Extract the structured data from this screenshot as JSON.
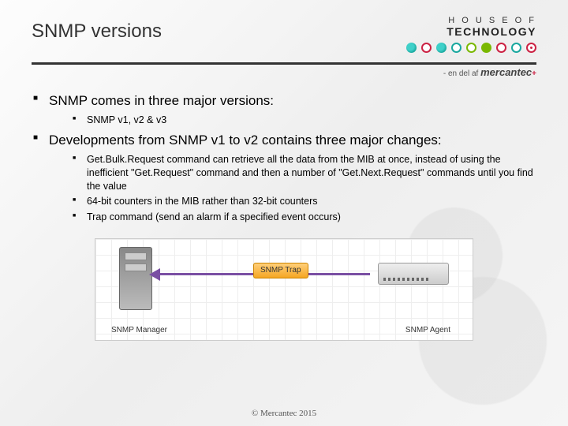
{
  "header": {
    "title": "SNMP versions",
    "brand_line1": "H O U S E  O F",
    "brand_line2": "TECHNOLOGY",
    "subbrand_prefix": "- en del af ",
    "subbrand_name": "mercantec",
    "subbrand_plus": "+"
  },
  "content": {
    "bullet1": "SNMP comes in three major versions:",
    "bullet1_sub1": "SNMP v1, v2 & v3",
    "bullet2": "Developments from SNMP v1 to v2 contains three major changes:",
    "bullet2_sub1": "Get.Bulk.Request command can retrieve all the data from the MIB at once, instead of using the inefficient \"Get.Request\" command and then a number of \"Get.Next.Request\" commands until you find the value",
    "bullet2_sub2": "64-bit counters in the MIB rather than 32-bit counters",
    "bullet2_sub3": "Trap command (send an alarm if a specified event occurs)"
  },
  "diagram": {
    "trap_label": "SNMP Trap",
    "manager_label": "SNMP Manager",
    "agent_label": "SNMP Agent"
  },
  "footer": {
    "copyright": "© Mercantec 2015"
  }
}
